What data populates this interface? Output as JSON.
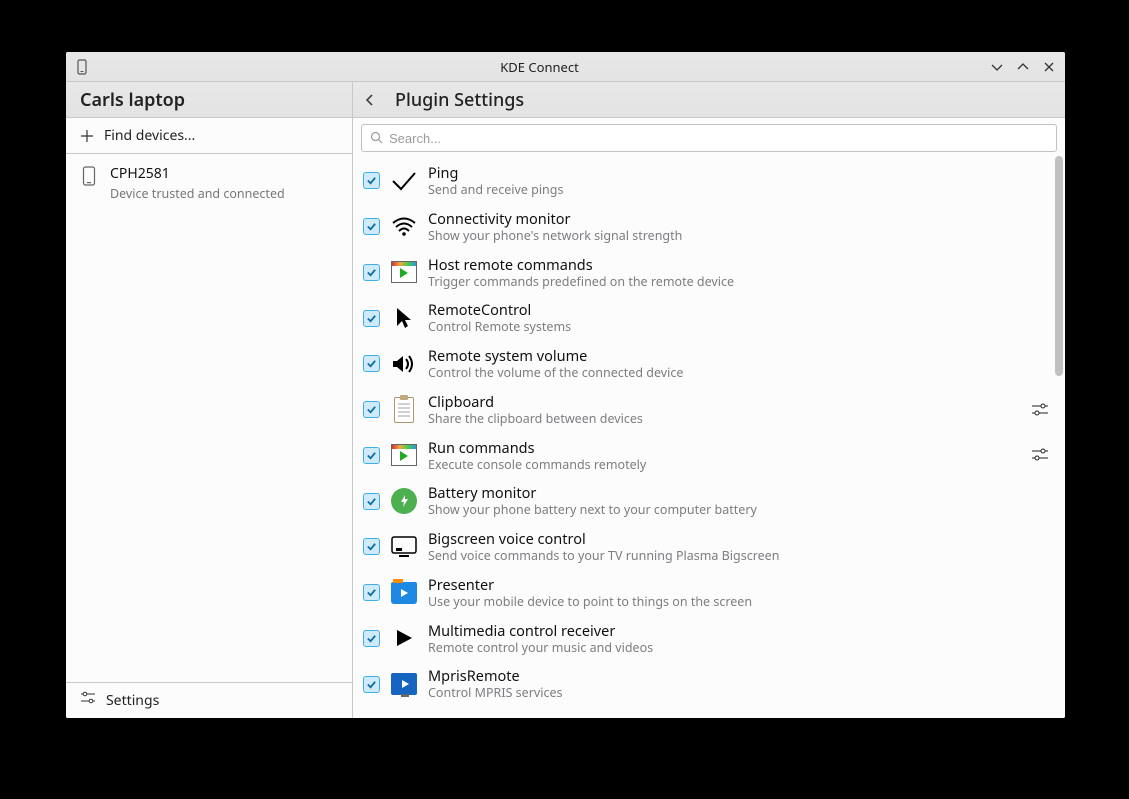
{
  "titlebar": {
    "title": "KDE Connect"
  },
  "sidebar": {
    "device_header": "Carls laptop",
    "find_devices": "Find devices...",
    "device": {
      "name": "CPH2581",
      "status": "Device trusted and connected"
    },
    "settings": "Settings"
  },
  "main": {
    "title": "Plugin Settings",
    "search_placeholder": "Search..."
  },
  "plugins": [
    {
      "title": "Ping",
      "desc": "Send and receive pings",
      "icon": "ping",
      "checked": true,
      "config": false
    },
    {
      "title": "Connectivity monitor",
      "desc": "Show your phone's network signal strength",
      "icon": "wifi",
      "checked": true,
      "config": false
    },
    {
      "title": "Host remote commands",
      "desc": "Trigger commands predefined on the remote device",
      "icon": "media",
      "checked": true,
      "config": false
    },
    {
      "title": "RemoteControl",
      "desc": "Control Remote systems",
      "icon": "cursor",
      "checked": true,
      "config": false
    },
    {
      "title": "Remote system volume",
      "desc": "Control the volume of the connected device",
      "icon": "volume",
      "checked": true,
      "config": false
    },
    {
      "title": "Clipboard",
      "desc": "Share the clipboard between devices",
      "icon": "clipboard",
      "checked": true,
      "config": true
    },
    {
      "title": "Run commands",
      "desc": "Execute console commands remotely",
      "icon": "media",
      "checked": true,
      "config": true
    },
    {
      "title": "Battery monitor",
      "desc": "Show your phone battery next to your computer battery",
      "icon": "battery",
      "checked": true,
      "config": false
    },
    {
      "title": "Bigscreen voice control",
      "desc": "Send voice commands to your TV running Plasma Bigscreen",
      "icon": "tv",
      "checked": true,
      "config": false
    },
    {
      "title": "Presenter",
      "desc": "Use your mobile device to point to things on the screen",
      "icon": "presenter",
      "checked": true,
      "config": false
    },
    {
      "title": "Multimedia control receiver",
      "desc": "Remote control your music and videos",
      "icon": "play",
      "checked": true,
      "config": false
    },
    {
      "title": "MprisRemote",
      "desc": "Control MPRIS services",
      "icon": "mpris",
      "checked": true,
      "config": false
    }
  ]
}
